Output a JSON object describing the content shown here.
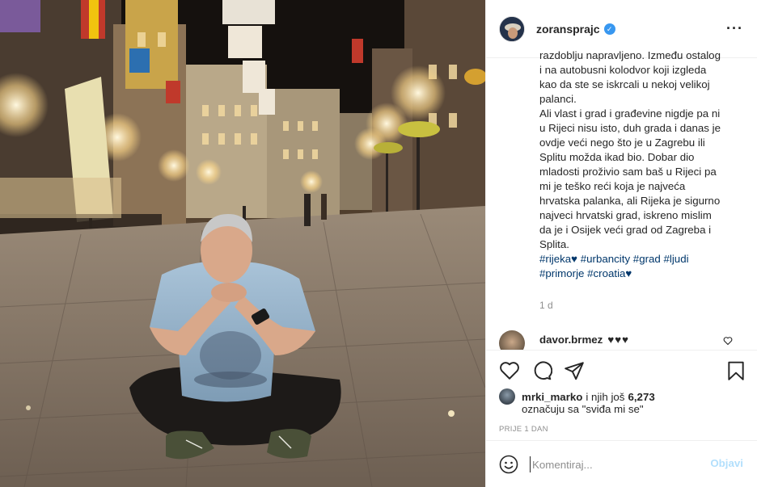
{
  "post": {
    "username": "zoransprajc",
    "verified_mark": "✓",
    "more_icon": "···",
    "caption_lines": [
      "razdoblju napravljeno. Između ostalog",
      "i na autobusni kolodvor koji izgleda",
      "kao da ste se iskrcali u nekoj velikoj",
      "palanci.",
      "Ali vlast i grad i građevine nigdje pa ni",
      "u Rijeci nisu isto, duh grada i danas je",
      "ovdje veći nego što je u Zagrebu ili",
      "Splitu možda ikad bio. Dobar dio",
      "mladosti proživio sam baš u Rijeci pa",
      "mi je teško reći koja je najveća",
      "hrvatska palanka, ali Rijeka je sigurno",
      "najveci hrvatski grad, iskreno mislim",
      "da je i Osijek veći grad od Zagreba i",
      "Splita."
    ],
    "hashtags_line1": "#rijeka♥ #urbancity #grad #ljudi",
    "hashtags_line2": "#primorje #croatia♥",
    "time_ago": "1 d"
  },
  "comments": [
    {
      "username": "davor.brmez",
      "text": "♥♥♥"
    }
  ],
  "likes": {
    "user": "mrki_marko",
    "connector": "i njih još",
    "count": "6,273",
    "suffix": "označuju sa \"sviđa mi se\""
  },
  "date_label": "PRIJE 1 DAN",
  "comment_box": {
    "placeholder": "Komentiraj...",
    "post_label": "Objavi"
  },
  "icons": {
    "like": "heart-icon",
    "comment": "comment-icon",
    "share": "share-icon",
    "save": "bookmark-icon",
    "emoji": "emoji-icon",
    "more": "more-icon",
    "verified": "verified-badge"
  },
  "colors": {
    "hashtag": "#00376b",
    "verified": "#3897f0",
    "post_button_disabled": "#b2dffc",
    "muted": "#8e8e8e"
  }
}
